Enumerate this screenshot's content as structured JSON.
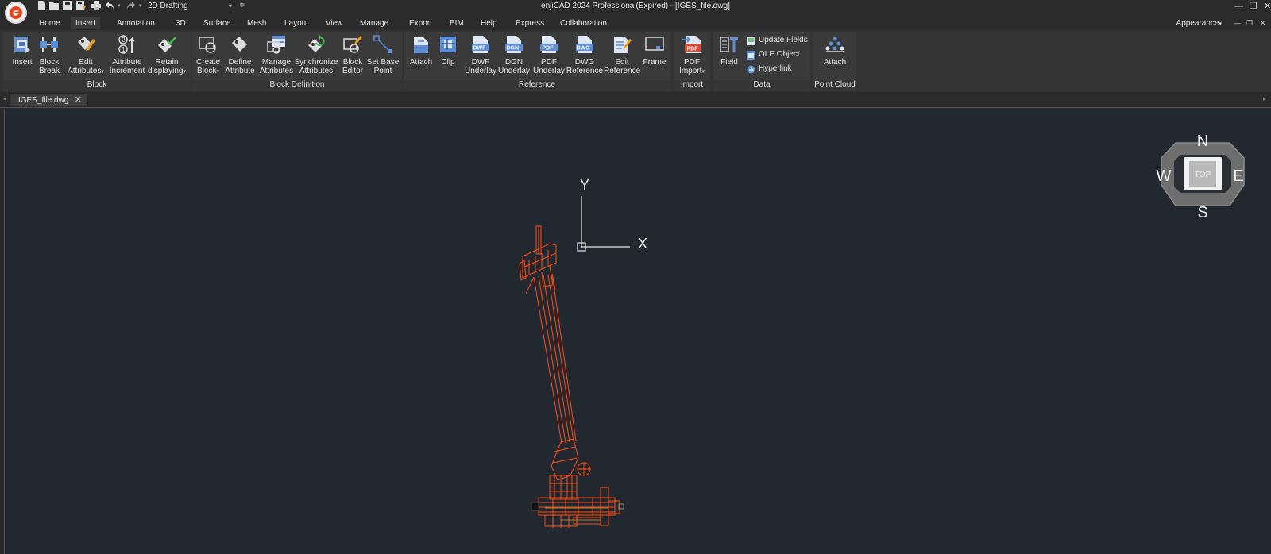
{
  "app": {
    "title": "enjiCAD 2024 Professional(Expired) - [IGES_file.dwg]",
    "workspace": "2D Drafting",
    "logo": "enjicad-logo"
  },
  "menu": {
    "tabs": [
      "Home",
      "Insert",
      "Annotation",
      "3D",
      "Surface",
      "Mesh",
      "Layout",
      "View",
      "Manage",
      "Export",
      "BIM",
      "Help",
      "Express",
      "Collaboration"
    ],
    "active_tab": "Insert",
    "appearance": "Appearance"
  },
  "ribbon": {
    "block": {
      "title": "Block",
      "buttons": [
        "Insert",
        "Block\nBreak",
        "Edit\nAttributes",
        "Attribute\nIncrement",
        "Retain\ndisplaying"
      ]
    },
    "block_definition": {
      "title": "Block Definition",
      "buttons": [
        "Create\nBlock",
        "Define\nAttribute",
        "Manage\nAttributes",
        "Synchronize\nAttributes",
        "Block\nEditor",
        "Set Base\nPoint"
      ]
    },
    "reference": {
      "title": "Reference",
      "buttons": [
        "Attach",
        "Clip",
        "DWF\nUnderlay",
        "DGN\nUnderlay",
        "PDF\nUnderlay",
        "DWG\nReference",
        "Edit\nReference",
        "Frame"
      ]
    },
    "import": {
      "title": "Import",
      "buttons": [
        "PDF\nImport"
      ]
    },
    "data": {
      "title": "Data",
      "field": "Field",
      "update_fields": "Update Fields",
      "ole_object": "OLE Object",
      "hyperlink": "Hyperlink"
    },
    "point_cloud": {
      "title": "Point Cloud",
      "buttons": [
        "Attach"
      ]
    }
  },
  "document": {
    "tab_name": "IGES_file.dwg"
  },
  "viewport": {
    "ucs_y": "Y",
    "ucs_x": "X",
    "compass": {
      "n": "N",
      "s": "S",
      "e": "E",
      "w": "W",
      "face": "TOP"
    }
  },
  "colors": {
    "accent_orange": "#ff4a12",
    "canvas_bg": "#212830",
    "ribbon_bg": "#333333"
  }
}
